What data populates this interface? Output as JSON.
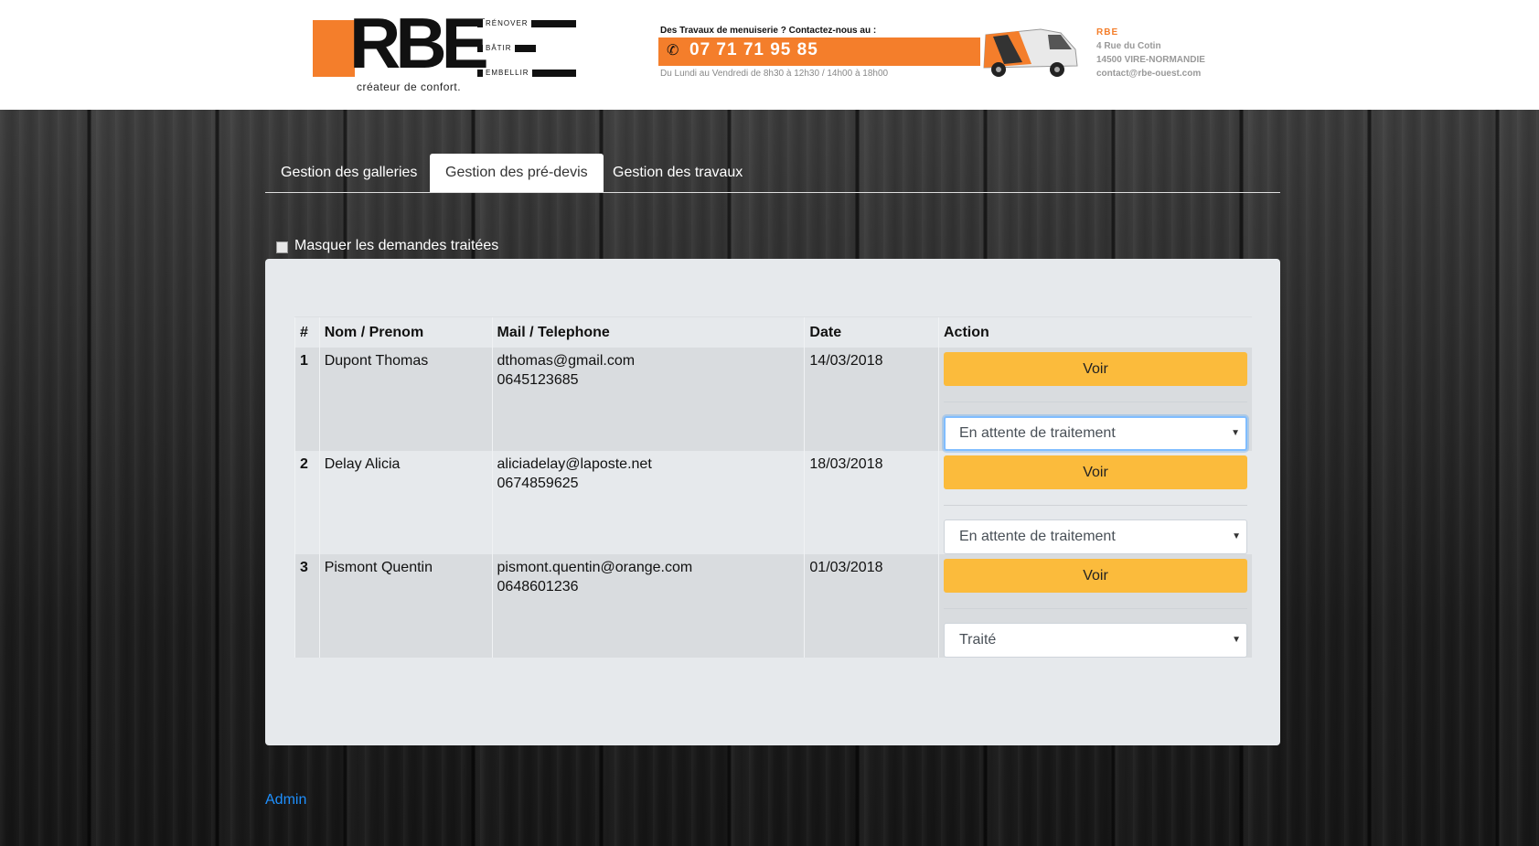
{
  "header": {
    "logo_letters": "RBE",
    "logo_words": [
      "RÉNOVER",
      "BÂTIR",
      "EMBELLIR"
    ],
    "logo_tagline": "créateur de confort.",
    "contact_intro": "Des Travaux de menuiserie ? Contactez-nous au :",
    "phone": "07 71 71 95 85",
    "hours": "Du Lundi au Vendredi de 8h30 à 12h30 / 14h00 à 18h00",
    "company": "RBE",
    "address_line1": "4 Rue du Cotin",
    "address_line2": "14500 VIRE-NORMANDIE",
    "email": "contact@rbe-ouest.com",
    "brand_color": "#f47e2b"
  },
  "tabs": [
    {
      "label": "Gestion des galleries",
      "active": false
    },
    {
      "label": "Gestion des pré-devis",
      "active": true
    },
    {
      "label": "Gestion des travaux",
      "active": false
    }
  ],
  "filter": {
    "label": "Masquer les demandes traitées",
    "checked": false
  },
  "table": {
    "headers": [
      "#",
      "Nom / Prenom",
      "Mail / Telephone",
      "Date",
      "Action"
    ],
    "rows": [
      {
        "num": "1",
        "name": "Dupont Thomas",
        "email": "dthomas@gmail.com",
        "phone": "0645123685",
        "date": "14/03/2018",
        "button": "Voir",
        "status": "En attente de traitement"
      },
      {
        "num": "2",
        "name": "Delay Alicia",
        "email": "aliciadelay@laposte.net",
        "phone": "0674859625",
        "date": "18/03/2018",
        "button": "Voir",
        "status": "En attente de traitement"
      },
      {
        "num": "3",
        "name": "Pismont Quentin",
        "email": "pismont.quentin@orange.com",
        "phone": "0648601236",
        "date": "01/03/2018",
        "button": "Voir",
        "status": "Traité"
      }
    ]
  },
  "footer": {
    "admin_link": "Admin"
  },
  "colors": {
    "voir_button": "#fbbb3c",
    "link": "#1e90ff"
  }
}
